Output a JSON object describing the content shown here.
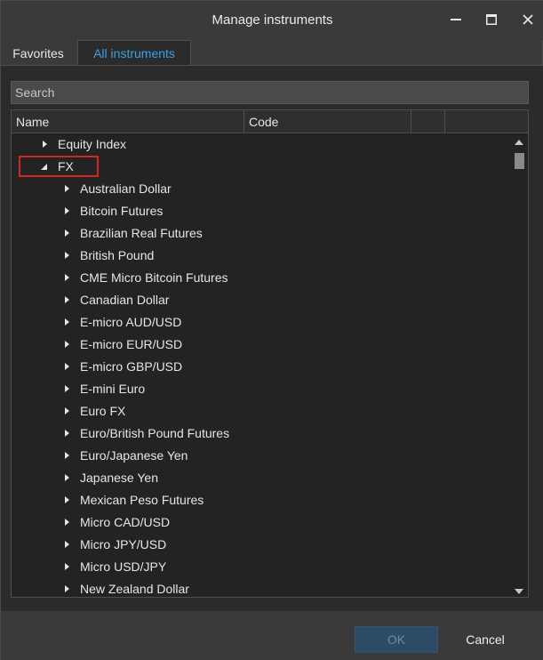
{
  "window": {
    "title": "Manage instruments"
  },
  "tabs": [
    {
      "label": "Favorites",
      "active": false
    },
    {
      "label": "All instruments",
      "active": true
    }
  ],
  "search": {
    "placeholder": "Search",
    "value": ""
  },
  "grid": {
    "columns": [
      "Name",
      "Code",
      "",
      ""
    ],
    "rows": [
      {
        "label": "Equity Index",
        "level": 0,
        "expanded": false
      },
      {
        "label": "FX",
        "level": 0,
        "expanded": true,
        "highlighted": true
      },
      {
        "label": "Australian Dollar",
        "level": 1,
        "expanded": false
      },
      {
        "label": "Bitcoin Futures",
        "level": 1,
        "expanded": false
      },
      {
        "label": "Brazilian Real Futures",
        "level": 1,
        "expanded": false
      },
      {
        "label": "British Pound",
        "level": 1,
        "expanded": false
      },
      {
        "label": "CME Micro Bitcoin Futures",
        "level": 1,
        "expanded": false
      },
      {
        "label": "Canadian Dollar",
        "level": 1,
        "expanded": false
      },
      {
        "label": "E-micro AUD/USD",
        "level": 1,
        "expanded": false
      },
      {
        "label": "E-micro EUR/USD",
        "level": 1,
        "expanded": false
      },
      {
        "label": "E-micro GBP/USD",
        "level": 1,
        "expanded": false
      },
      {
        "label": "E-mini Euro",
        "level": 1,
        "expanded": false
      },
      {
        "label": "Euro FX",
        "level": 1,
        "expanded": false
      },
      {
        "label": "Euro/British Pound Futures",
        "level": 1,
        "expanded": false
      },
      {
        "label": "Euro/Japanese Yen",
        "level": 1,
        "expanded": false
      },
      {
        "label": "Japanese Yen",
        "level": 1,
        "expanded": false
      },
      {
        "label": "Mexican Peso Futures",
        "level": 1,
        "expanded": false
      },
      {
        "label": "Micro CAD/USD",
        "level": 1,
        "expanded": false
      },
      {
        "label": "Micro JPY/USD",
        "level": 1,
        "expanded": false
      },
      {
        "label": "Micro USD/JPY",
        "level": 1,
        "expanded": false
      },
      {
        "label": "New Zealand Dollar",
        "level": 1,
        "expanded": false
      }
    ]
  },
  "footer": {
    "ok_label": "OK",
    "cancel_label": "Cancel"
  },
  "colors": {
    "accent": "#3ea0e6",
    "highlight": "#d42525",
    "background": "#2b2b2b"
  }
}
